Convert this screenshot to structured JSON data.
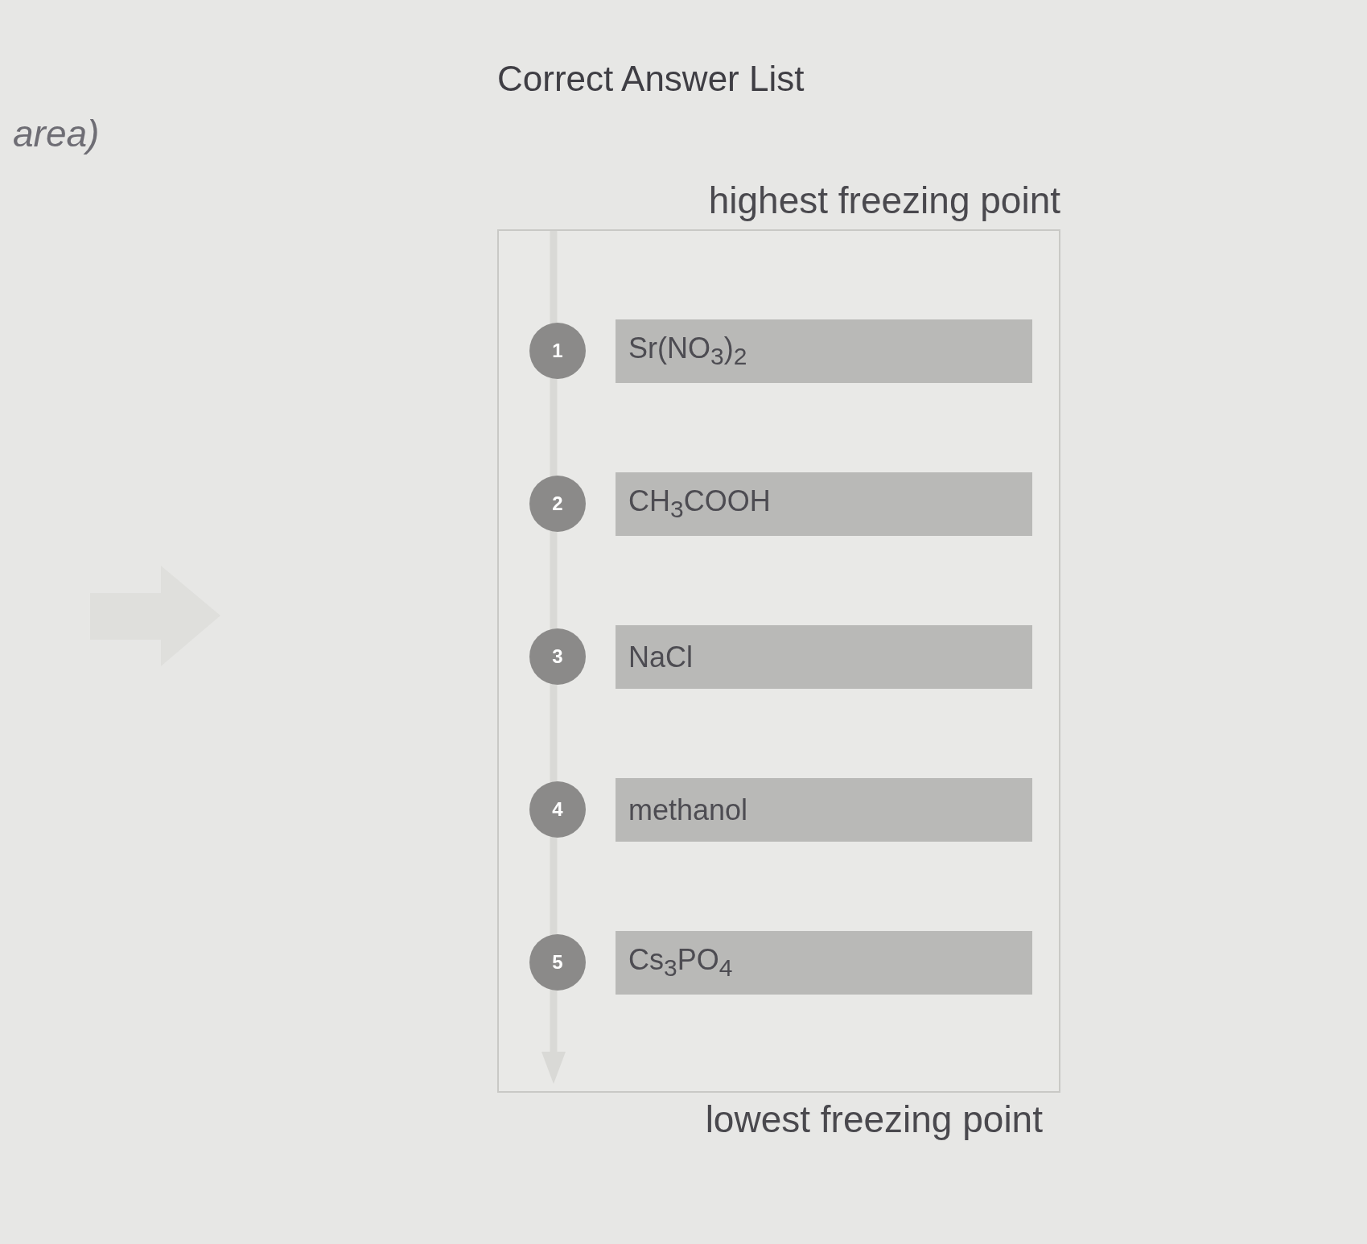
{
  "side_text": {
    "text": "area)"
  },
  "title": "Correct Answer List",
  "ranking": {
    "top_label": "highest freezing point",
    "items": [
      {
        "rank": "1",
        "answer": "Sr(NO$_{3}$)$_{2}$"
      },
      {
        "rank": "2",
        "answer": "CH$_{3}$COOH"
      },
      {
        "rank": "3",
        "answer": "NaCl"
      },
      {
        "rank": "4",
        "answer": "methanol"
      },
      {
        "rank": "5",
        "answer": "Cs$_{3}$PO$_{4}$"
      }
    ],
    "bottom_label": "lowest freezing point"
  }
}
